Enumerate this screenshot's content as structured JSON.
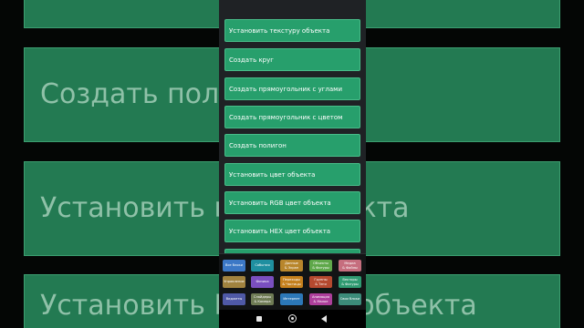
{
  "background_cards": [
    {
      "label": ""
    },
    {
      "label": "Создать полигон"
    },
    {
      "label": "Установить цвет объекта"
    },
    {
      "label": "Установить RGB цвет объекта"
    }
  ],
  "blocks": [
    {
      "label": "Установить текстуру объекта"
    },
    {
      "label": "Создать круг"
    },
    {
      "label": "Создать прямоугольник с углами"
    },
    {
      "label": "Создать прямоугольник с цветом"
    },
    {
      "label": "Создать полигон"
    },
    {
      "label": "Установить цвет объекта"
    },
    {
      "label": "Установить RGB цвет объекта"
    },
    {
      "label": "Установить HEX цвет объекта"
    },
    {
      "label": ""
    }
  ],
  "categories": [
    {
      "label": "Все блоки",
      "color": "#3c78c6"
    },
    {
      "label": "События",
      "color": "#1f8fa0"
    },
    {
      "label": "Данные\n& Экран",
      "color": "#b8862c"
    },
    {
      "label": "Объекты\n& Фигуры",
      "color": "#5fa84a"
    },
    {
      "label": "Медиа\n& Файлы",
      "color": "#c66e7e"
    },
    {
      "label": "Управление",
      "color": "#a1833f"
    },
    {
      "label": "Физика",
      "color": "#7a4fbf"
    },
    {
      "label": "Переходы\n& Частицы",
      "color": "#c5801d"
    },
    {
      "label": "Группы\n& Теги",
      "color": "#b5492f"
    },
    {
      "label": "Векторы\n& Фигуры",
      "color": "#2f9a71"
    },
    {
      "label": "Виджеты",
      "color": "#4f59a6"
    },
    {
      "label": "Слайдеры\n& Камера",
      "color": "#6f7c55"
    },
    {
      "label": "Интернет",
      "color": "#2c78b8"
    },
    {
      "label": "Анимация\n& Малое",
      "color": "#ad3f9b"
    },
    {
      "label": "Свои блоки",
      "color": "#3c8c7a"
    }
  ],
  "navbar": {
    "recents": "square-icon",
    "home": "circle-home-icon",
    "back": "triangle-back-icon"
  }
}
